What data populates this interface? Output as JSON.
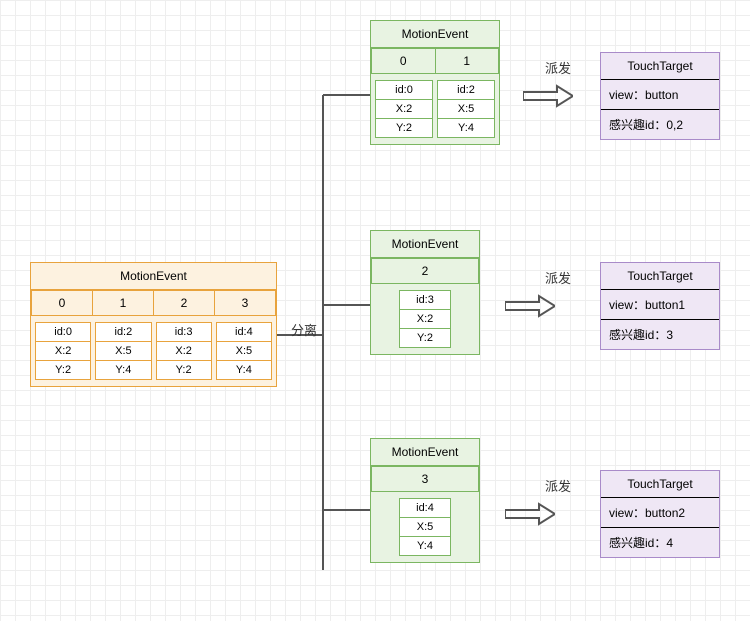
{
  "labels": {
    "split": "分离",
    "dispatch": "派发"
  },
  "source": {
    "title": "MotionEvent",
    "columns": [
      "0",
      "1",
      "2",
      "3"
    ],
    "pointers": [
      {
        "id": "id:0",
        "x": "X:2",
        "y": "Y:2"
      },
      {
        "id": "id:2",
        "x": "X:5",
        "y": "Y:4"
      },
      {
        "id": "id:3",
        "x": "X:2",
        "y": "Y:2"
      },
      {
        "id": "id:4",
        "x": "X:5",
        "y": "Y:4"
      }
    ]
  },
  "splits": [
    {
      "title": "MotionEvent",
      "columns": [
        "0",
        "1"
      ],
      "pointers": [
        {
          "id": "id:0",
          "x": "X:2",
          "y": "Y:2"
        },
        {
          "id": "id:2",
          "x": "X:5",
          "y": "Y:4"
        }
      ],
      "target": {
        "title": "TouchTarget",
        "view": "view：button",
        "ids": "感兴趣id：0,2"
      }
    },
    {
      "title": "MotionEvent",
      "columns": [
        "2"
      ],
      "pointers": [
        {
          "id": "id:3",
          "x": "X:2",
          "y": "Y:2"
        }
      ],
      "target": {
        "title": "TouchTarget",
        "view": "view：button1",
        "ids": "感兴趣id：3"
      }
    },
    {
      "title": "MotionEvent",
      "columns": [
        "3"
      ],
      "pointers": [
        {
          "id": "id:4",
          "x": "X:5",
          "y": "Y:4"
        }
      ],
      "target": {
        "title": "TouchTarget",
        "view": "view：button2",
        "ids": "感兴趣id：4"
      }
    }
  ]
}
